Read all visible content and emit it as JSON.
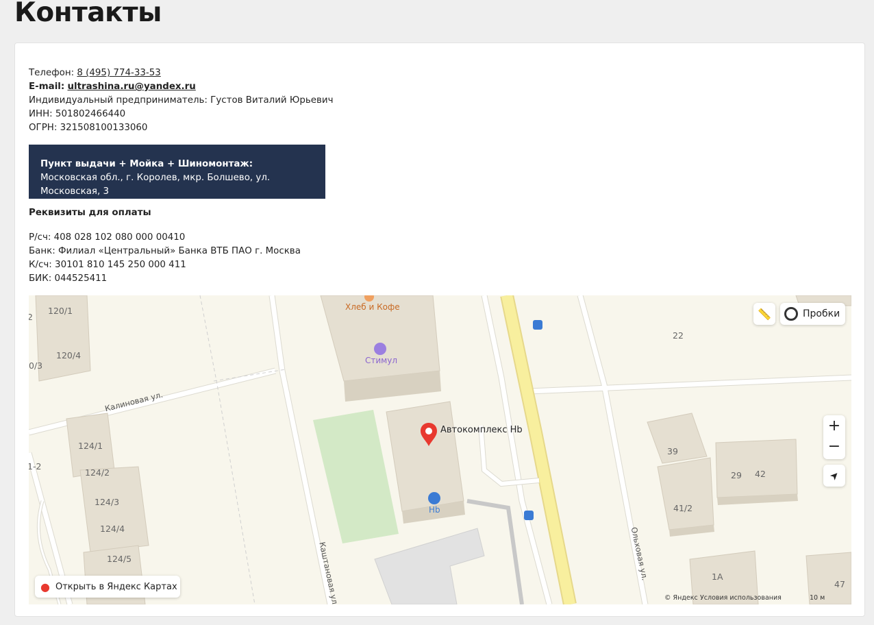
{
  "page": {
    "title": "Контакты"
  },
  "contacts": {
    "phone_label": "Телефон:",
    "phone": "8 (495) 774-33-53",
    "email_label": "E-mail:",
    "email": "ultrashina.ru@yandex.ru",
    "entrepreneur": "Индивидуальный предприниматель: Густов Виталий Юрьевич",
    "inn": "ИНН: 501802466440",
    "ogrn": "ОГРН: 321508100133060"
  },
  "pickup": {
    "title": "Пункт выдачи + Мойка + Шиномонтаж:",
    "address": "Московская обл., г. Королев, мкр. Болшево, ул. Московская, 3"
  },
  "requisites": {
    "title": "Реквизиты для оплаты",
    "account": "Р/сч: 408 028 102 080 000 00410",
    "bank": "Банк: Филиал «Центральный» Банка ВТБ ПАО г. Москва",
    "corr": "К/сч: 30101 810 145 250 000 411",
    "bik": "БИК: 044525411"
  },
  "map": {
    "poi_bread": "Хлеб и Кофе",
    "poi_stimul": "Стимул",
    "poi_marker": "Автокомплекс Hb",
    "poi_hb": "Hb",
    "street_kalinovaya": "Калиновая ул.",
    "street_kashtanovaya": "Каштановая ул.",
    "street_olhovaya": "Ольховая ул.",
    "houses": {
      "h2": "2",
      "h120_1": "120/1",
      "h120_4": "120/4",
      "h0_3": "0/3",
      "h124_1": "124/1",
      "h124_2": "124/2",
      "h124_3": "124/3",
      "h124_4": "124/4",
      "h124_5": "124/5",
      "h1_2": "1-2",
      "h22": "22",
      "h39": "39",
      "h29": "29",
      "h42": "42",
      "h41_2": "41/2",
      "h1a": "1А",
      "h47": "47"
    },
    "traffic_label": "Пробки",
    "open_label": "Открыть в Яндекс Картах",
    "copyright": "© Яндекс",
    "terms": "Условия использования",
    "scale": "10 м",
    "zoom_in": "+",
    "zoom_out": "−"
  }
}
